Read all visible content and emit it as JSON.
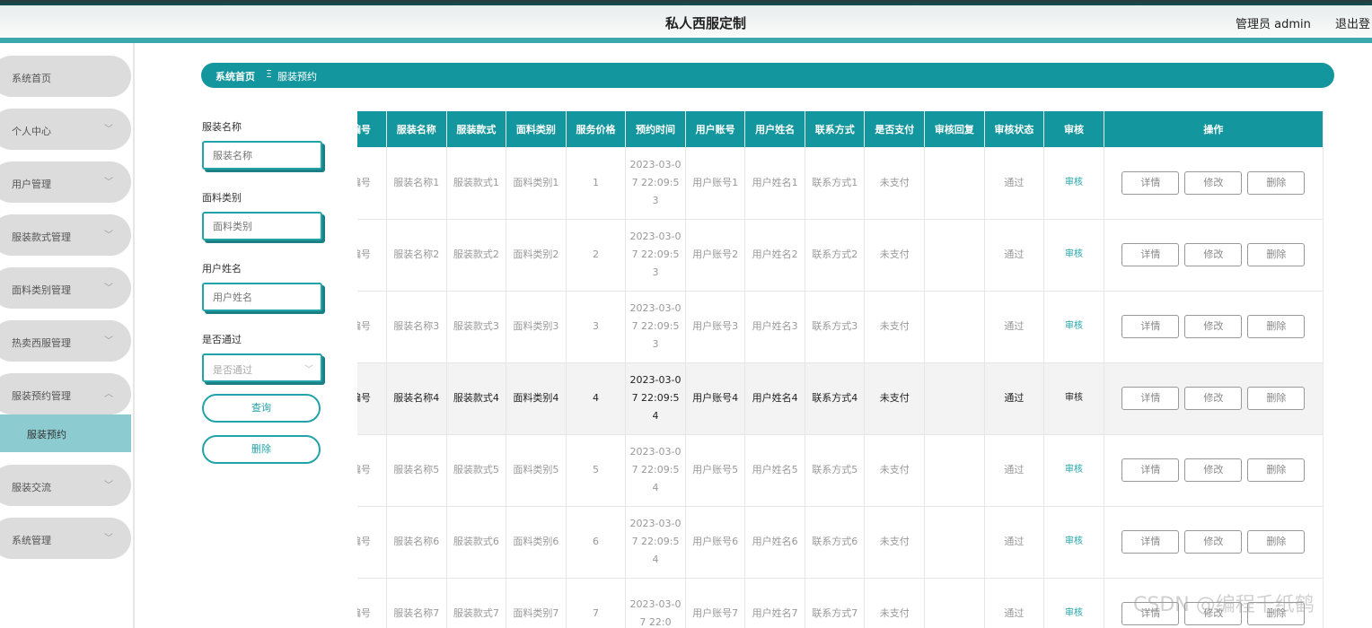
{
  "header": {
    "title": "私人西服定制",
    "admin": "管理员 admin",
    "logout": "退出登"
  },
  "sidebar": {
    "items": [
      {
        "label": "系统首页",
        "chevron": false
      },
      {
        "label": "个人中心",
        "chevron": true
      },
      {
        "label": "用户管理",
        "chevron": true
      },
      {
        "label": "服装款式管理",
        "chevron": true
      },
      {
        "label": "面料类别管理",
        "chevron": true
      },
      {
        "label": "热卖西服管理",
        "chevron": true
      },
      {
        "label": "服装预约管理",
        "chevron": true,
        "expanded": true
      },
      {
        "label": "服装交流",
        "chevron": true
      },
      {
        "label": "系统管理",
        "chevron": true
      }
    ],
    "active_sub": "服装预约"
  },
  "breadcrumb": {
    "home": "系统首页",
    "separator": "Ξ",
    "current": "服装预约"
  },
  "filters": {
    "name_label": "服装名称",
    "name_placeholder": "服装名称",
    "fabric_label": "面料类别",
    "fabric_placeholder": "面料类别",
    "user_label": "用户姓名",
    "user_placeholder": "用户姓名",
    "pass_label": "是否通过",
    "pass_placeholder": "是否通过",
    "query_button": "查询",
    "delete_button": "删除"
  },
  "table": {
    "columns": [
      "编号",
      "服装名称",
      "服装款式",
      "面料类别",
      "服务价格",
      "预约时间",
      "用户账号",
      "用户姓名",
      "联系方式",
      "是否支付",
      "审核回复",
      "审核状态",
      "审核",
      "操作"
    ],
    "rows": [
      {
        "id": "编号",
        "name": "服装名称1",
        "style": "服装款式1",
        "fabric": "面料类别1",
        "price": "1",
        "time": "2023-03-07 22:09:53",
        "account": "用户账号1",
        "user": "用户姓名1",
        "contact": "联系方式1",
        "paid": "未支付",
        "reply": "",
        "status": "通过",
        "audit": "审核"
      },
      {
        "id": "编号",
        "name": "服装名称2",
        "style": "服装款式2",
        "fabric": "面料类别2",
        "price": "2",
        "time": "2023-03-07 22:09:53",
        "account": "用户账号2",
        "user": "用户姓名2",
        "contact": "联系方式2",
        "paid": "未支付",
        "reply": "",
        "status": "通过",
        "audit": "审核"
      },
      {
        "id": "编号",
        "name": "服装名称3",
        "style": "服装款式3",
        "fabric": "面料类别3",
        "price": "3",
        "time": "2023-03-07 22:09:53",
        "account": "用户账号3",
        "user": "用户姓名3",
        "contact": "联系方式3",
        "paid": "未支付",
        "reply": "",
        "status": "通过",
        "audit": "审核"
      },
      {
        "id": "编号",
        "name": "服装名称4",
        "style": "服装款式4",
        "fabric": "面料类别4",
        "price": "4",
        "time": "2023-03-07 22:09:54",
        "account": "用户账号4",
        "user": "用户姓名4",
        "contact": "联系方式4",
        "paid": "未支付",
        "reply": "",
        "status": "通过",
        "audit": "审核"
      },
      {
        "id": "编号",
        "name": "服装名称5",
        "style": "服装款式5",
        "fabric": "面料类别5",
        "price": "5",
        "time": "2023-03-07 22:09:54",
        "account": "用户账号5",
        "user": "用户姓名5",
        "contact": "联系方式5",
        "paid": "未支付",
        "reply": "",
        "status": "通过",
        "audit": "审核"
      },
      {
        "id": "编号",
        "name": "服装名称6",
        "style": "服装款式6",
        "fabric": "面料类别6",
        "price": "6",
        "time": "2023-03-07 22:09:54",
        "account": "用户账号6",
        "user": "用户姓名6",
        "contact": "联系方式6",
        "paid": "未支付",
        "reply": "",
        "status": "通过",
        "audit": "审核"
      },
      {
        "id": "编号",
        "name": "服装名称7",
        "style": "服装款式7",
        "fabric": "面料类别7",
        "price": "7",
        "time": "2023-03-07 22:0",
        "account": "用户账号7",
        "user": "用户姓名7",
        "contact": "联系方式7",
        "paid": "未支付",
        "reply": "",
        "status": "通过",
        "audit": "审核"
      }
    ],
    "highlight_row": 3,
    "action_labels": {
      "detail": "详情",
      "edit": "修改",
      "delete": "删除"
    }
  },
  "watermark": "CSDN @编程千纸鹤",
  "colors": {
    "accent": "#14969e",
    "header_line": "#3ba8ad",
    "menu_bg": "#dcdcdc",
    "active_sub": "#8ccbd0"
  }
}
